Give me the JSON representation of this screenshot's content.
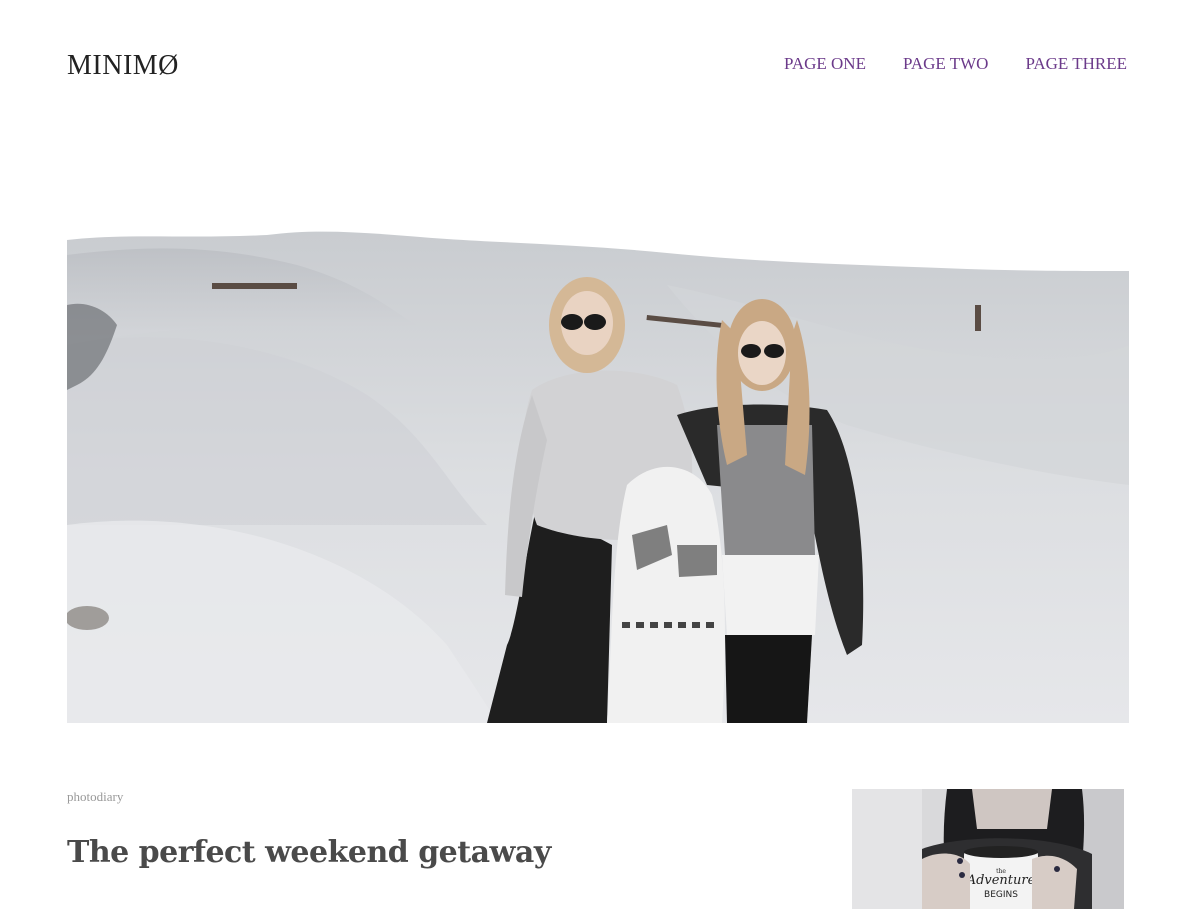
{
  "header": {
    "logo": "MINIMØ",
    "nav": [
      {
        "label": "PAGE ONE"
      },
      {
        "label": "PAGE TWO"
      },
      {
        "label": "PAGE THREE"
      }
    ]
  },
  "hero": {
    "image": "two-women-on-sand-dunes-photo"
  },
  "post": {
    "category": "photodiary",
    "title": "The perfect weekend getaway",
    "thumbnail": "hands-holding-mug-photo",
    "mug_text_small": "the",
    "mug_text_main": "Adventure",
    "mug_text_sub": "BEGINS"
  },
  "colors": {
    "nav_link": "#6b3a8a",
    "logo": "#222222",
    "title": "#4a4a4a",
    "meta": "#999999"
  }
}
